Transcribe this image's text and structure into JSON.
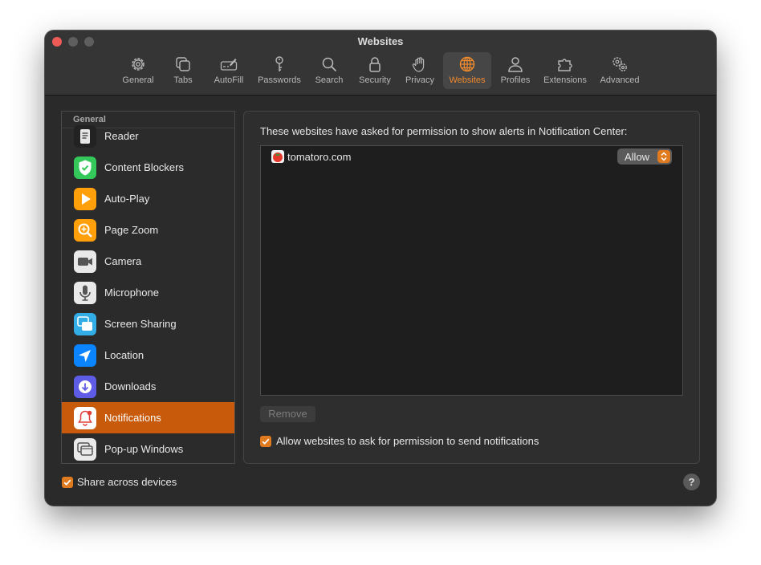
{
  "window": {
    "title": "Websites"
  },
  "toolbar": {
    "items": [
      {
        "label": "General",
        "icon": "gear-icon"
      },
      {
        "label": "Tabs",
        "icon": "tabs-icon"
      },
      {
        "label": "AutoFill",
        "icon": "autofill-icon"
      },
      {
        "label": "Passwords",
        "icon": "key-icon"
      },
      {
        "label": "Search",
        "icon": "magnifier-icon"
      },
      {
        "label": "Security",
        "icon": "lock-icon"
      },
      {
        "label": "Privacy",
        "icon": "hand-icon"
      },
      {
        "label": "Websites",
        "icon": "globe-icon",
        "active": true
      },
      {
        "label": "Profiles",
        "icon": "person-icon"
      },
      {
        "label": "Extensions",
        "icon": "puzzle-icon"
      },
      {
        "label": "Advanced",
        "icon": "gears-icon"
      }
    ]
  },
  "sidebar": {
    "header": "General",
    "items": [
      {
        "label": "Reader",
        "icon": "reader-icon"
      },
      {
        "label": "Content Blockers",
        "icon": "shield-check-icon"
      },
      {
        "label": "Auto-Play",
        "icon": "play-icon"
      },
      {
        "label": "Page Zoom",
        "icon": "zoom-icon"
      },
      {
        "label": "Camera",
        "icon": "camera-icon"
      },
      {
        "label": "Microphone",
        "icon": "microphone-icon"
      },
      {
        "label": "Screen Sharing",
        "icon": "screen-sharing-icon"
      },
      {
        "label": "Location",
        "icon": "location-arrow-icon"
      },
      {
        "label": "Downloads",
        "icon": "download-icon"
      },
      {
        "label": "Notifications",
        "icon": "bell-icon",
        "selected": true
      },
      {
        "label": "Pop-up Windows",
        "icon": "popup-windows-icon"
      }
    ]
  },
  "panel": {
    "description": "These websites have asked for permission to show alerts in Notification Center:",
    "sites": [
      {
        "name": "tomatoro.com",
        "icon": "tomato-favicon-icon",
        "permission": "Allow"
      }
    ],
    "remove_label": "Remove",
    "allow_ask_label": "Allow websites to ask for permission to send notifications",
    "allow_ask_checked": true
  },
  "footer": {
    "share_label": "Share across devices",
    "share_checked": true,
    "help_label": "?"
  },
  "colors": {
    "accent": "#e07a1f",
    "selection": "#c85a0b",
    "window_bg": "#2a2a2a"
  }
}
